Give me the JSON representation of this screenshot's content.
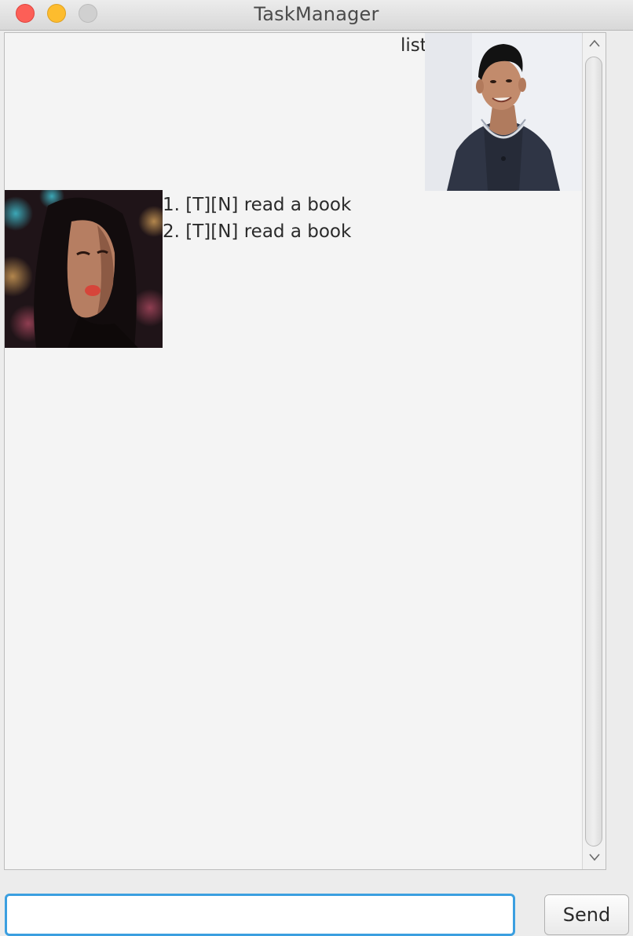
{
  "window": {
    "title": "TaskManager"
  },
  "dialog": {
    "user_message": "list",
    "bot_response_lines": [
      "1. [T][N] read a book",
      "2. [T][N] read a book"
    ]
  },
  "input": {
    "value": "",
    "placeholder": ""
  },
  "send_button": {
    "label": "Send"
  },
  "icons": {
    "scroll_up": "chevron-up-icon",
    "scroll_down": "chevron-down-icon"
  },
  "colors": {
    "input_focus_border": "#3b9fe0",
    "close_button": "#fc5f57",
    "minimize_button": "#fdbc2e",
    "zoom_button": "#d0d0d0"
  }
}
